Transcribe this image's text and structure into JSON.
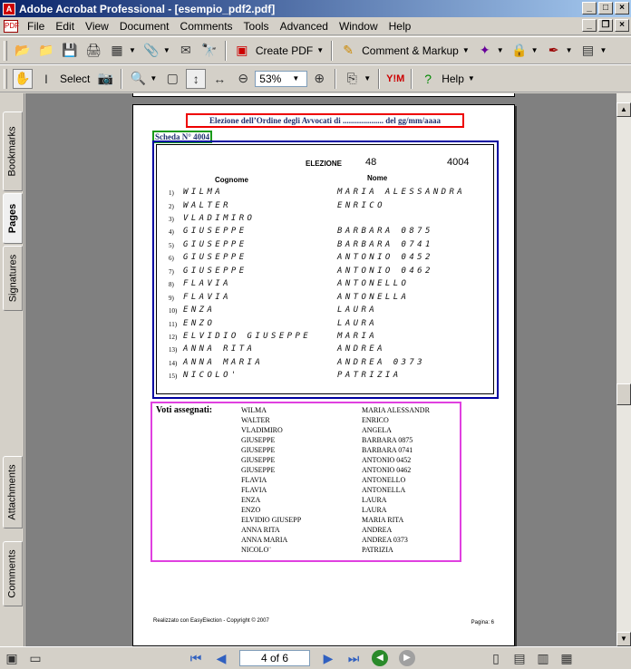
{
  "window": {
    "title": "Adobe Acrobat Professional - [esempio_pdf2.pdf]",
    "app_icon_text": "A"
  },
  "menu": [
    "File",
    "Edit",
    "View",
    "Document",
    "Comments",
    "Tools",
    "Advanced",
    "Window",
    "Help"
  ],
  "toolbar1": {
    "create_pdf": "Create PDF",
    "comment_markup": "Comment & Markup"
  },
  "toolbar2": {
    "select": "Select",
    "zoom": "53%",
    "help": "Help"
  },
  "left_tabs": [
    "Bookmarks",
    "Pages",
    "Signatures",
    "Attachments",
    "Comments"
  ],
  "status": {
    "page_indicator": "4 of 6"
  },
  "document": {
    "title": "Elezione dell’Ordine degli Avvocati di  ....................  del gg/mm/aaaa",
    "scheda": "Scheda N° 4004",
    "ballot": {
      "elezione_label": "ELEZIONE",
      "elezione_number": "48",
      "scheda_number": "4004",
      "col_cognome": "Cognome",
      "col_nome": "Nome",
      "rows": [
        {
          "n": "1)",
          "cognome": "WILMA",
          "nome": "MARIA ALESSANDRA"
        },
        {
          "n": "2)",
          "cognome": "WALTER",
          "nome": "ENRICO"
        },
        {
          "n": "3)",
          "cognome": "VLADIMIRO",
          "nome": ""
        },
        {
          "n": "4)",
          "cognome": "GIUSEPPE",
          "nome": "BARBARA 0875"
        },
        {
          "n": "5)",
          "cognome": "GIUSEPPE",
          "nome": "BARBARA 0741"
        },
        {
          "n": "6)",
          "cognome": "GIUSEPPE",
          "nome": "ANTONIO 0452"
        },
        {
          "n": "7)",
          "cognome": "GIUSEPPE",
          "nome": "ANTONIO 0462"
        },
        {
          "n": "8)",
          "cognome": "FLAVIA",
          "nome": "ANTONELLO"
        },
        {
          "n": "9)",
          "cognome": "FLAVIA",
          "nome": "ANTONELLA"
        },
        {
          "n": "10)",
          "cognome": "ENZA",
          "nome": "LAURA"
        },
        {
          "n": "11)",
          "cognome": "ENZO",
          "nome": "LAURA"
        },
        {
          "n": "12)",
          "cognome": "ELVIDIO GIUSEPPE",
          "nome": "MARIA"
        },
        {
          "n": "13)",
          "cognome": "ANNA RITA",
          "nome": "ANDREA"
        },
        {
          "n": "14)",
          "cognome": "ANNA MARIA",
          "nome": "ANDREA 0373"
        },
        {
          "n": "15)",
          "cognome": "NICOLO'",
          "nome": "PATRIZIA"
        }
      ]
    },
    "voti": {
      "label": "Voti assegnati:",
      "rows": [
        {
          "cognome": "WILMA",
          "nome": "MARIA ALESSANDR"
        },
        {
          "cognome": "WALTER",
          "nome": "ENRICO"
        },
        {
          "cognome": "VLADIMIRO",
          "nome": "ANGELA"
        },
        {
          "cognome": "GIUSEPPE",
          "nome": "BARBARA 0875"
        },
        {
          "cognome": "GIUSEPPE",
          "nome": "BARBARA 0741"
        },
        {
          "cognome": "GIUSEPPE",
          "nome": "ANTONIO 0452"
        },
        {
          "cognome": "GIUSEPPE",
          "nome": "ANTONIO 0462"
        },
        {
          "cognome": "FLAVIA",
          "nome": "ANTONELLO"
        },
        {
          "cognome": "FLAVIA",
          "nome": "ANTONELLA"
        },
        {
          "cognome": "ENZA",
          "nome": "LAURA"
        },
        {
          "cognome": "ENZO",
          "nome": "LAURA"
        },
        {
          "cognome": "ELVIDIO GIUSEPP",
          "nome": "MARIA RITA"
        },
        {
          "cognome": "ANNA RITA",
          "nome": "ANDREA"
        },
        {
          "cognome": "ANNA MARIA",
          "nome": "ANDREA 0373"
        },
        {
          "cognome": "NICOLO¨",
          "nome": "PATRIZIA"
        }
      ]
    },
    "footer_left": "Realizzato con EasyElection - Copyright © 2007",
    "footer_right": "Pagina: 6"
  },
  "colors": {
    "title_box": "#e00000",
    "scheda_box": "#1a9a1a",
    "ballot_box": "#0000a0",
    "voti_box": "#e040e0"
  }
}
